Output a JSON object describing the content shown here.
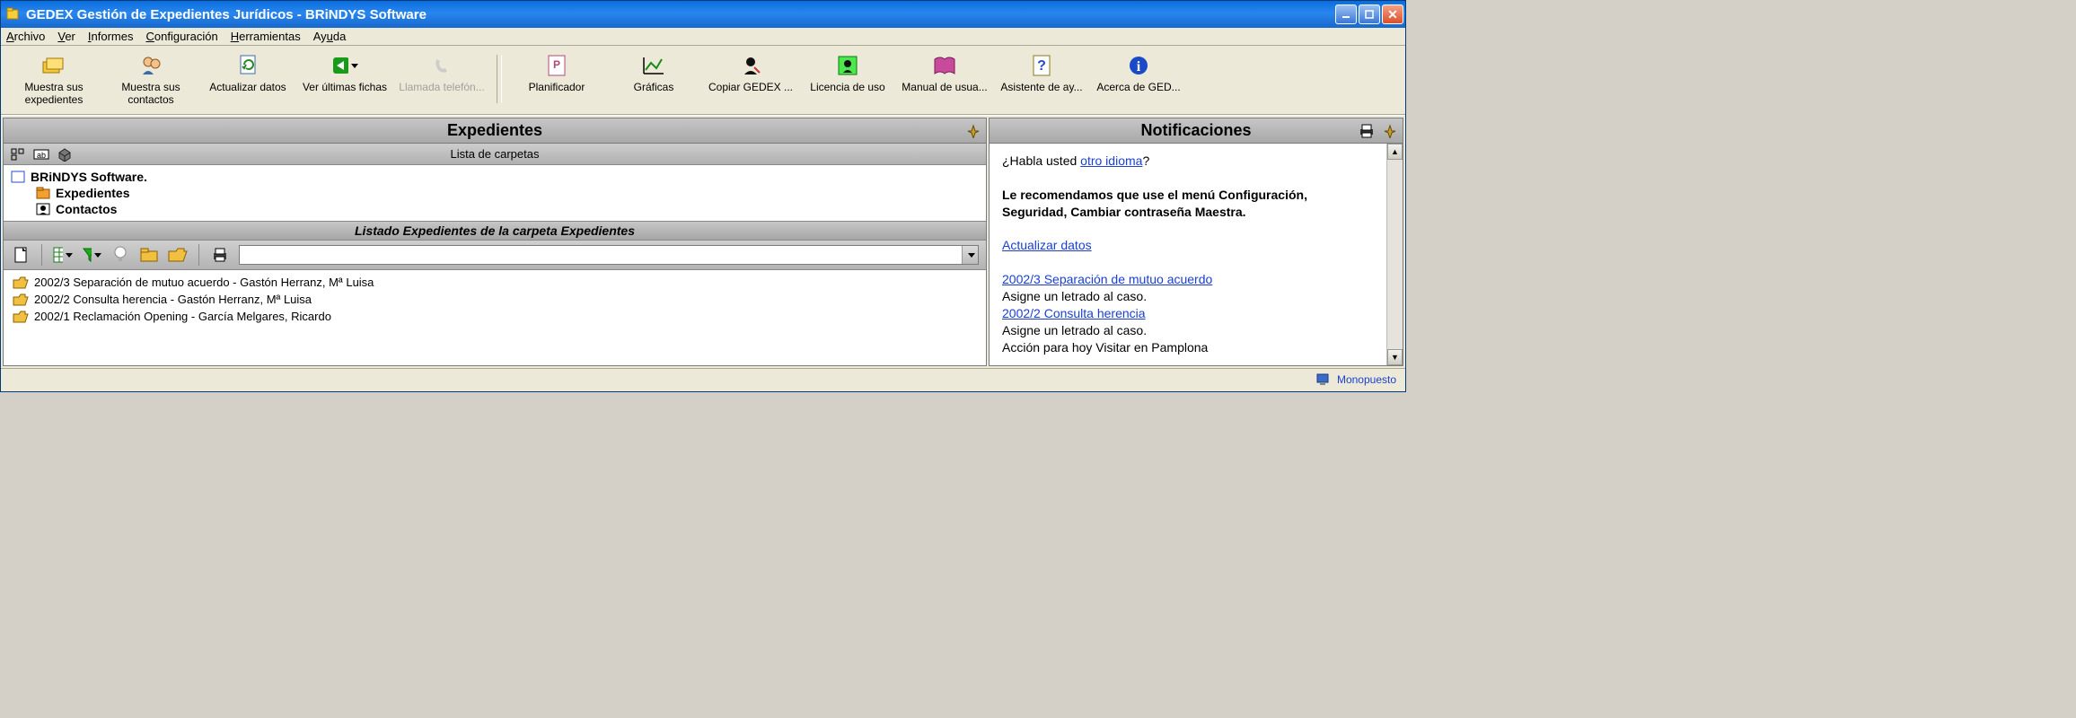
{
  "window": {
    "title": "GEDEX Gestión de Expedientes Jurídicos - BRiNDYS Software"
  },
  "menu": {
    "archivo": "Archivo",
    "ver": "Ver",
    "informes": "Informes",
    "configuracion": "Configuración",
    "herramientas": "Herramientas",
    "ayuda": "Ayuda"
  },
  "toolbar": {
    "muestra_expedientes": "Muestra sus expedientes",
    "muestra_contactos": "Muestra sus contactos",
    "actualizar_datos": "Actualizar datos",
    "ver_ultimas": "Ver últimas fichas",
    "llamada": "Llamada telefón...",
    "planificador": "Planificador",
    "graficas": "Gráficas",
    "copiar": "Copiar GEDEX ...",
    "licencia": "Licencia de uso",
    "manual": "Manual de usua...",
    "asistente": "Asistente de ay...",
    "acerca": "Acerca de GED..."
  },
  "left": {
    "header": "Expedientes",
    "subheader": "Lista de carpetas",
    "tree": {
      "root": "BRiNDYS Software.",
      "node1": "Expedientes",
      "node2": "Contactos"
    },
    "midbar": "Listado Expedientes de la carpeta Expedientes",
    "rows": [
      "2002/3 Separación de mutuo acuerdo  - Gastón Herranz, Mª Luisa",
      "2002/2 Consulta herencia  - Gastón Herranz, Mª Luisa",
      "2002/1 Reclamación Opening  - García Melgares, Ricardo"
    ]
  },
  "right": {
    "header": "Notificaciones",
    "q_prefix": "¿Habla usted ",
    "q_link": "otro idioma",
    "q_suffix": "?",
    "recommend": "Le recomendamos que use el menú Configuración, Seguridad, Cambiar contraseña Maestra.",
    "actualizar_link": "Actualizar datos",
    "case1_link": "2002/3 Separación de mutuo acuerdo",
    "asigne1": "Asigne un letrado al caso.",
    "case2_link": "2002/2 Consulta herencia",
    "asigne2": "Asigne un letrado al caso.",
    "accion": "Acción para hoy Visitar en Pamplona"
  },
  "status": {
    "mode": "Monopuesto"
  }
}
